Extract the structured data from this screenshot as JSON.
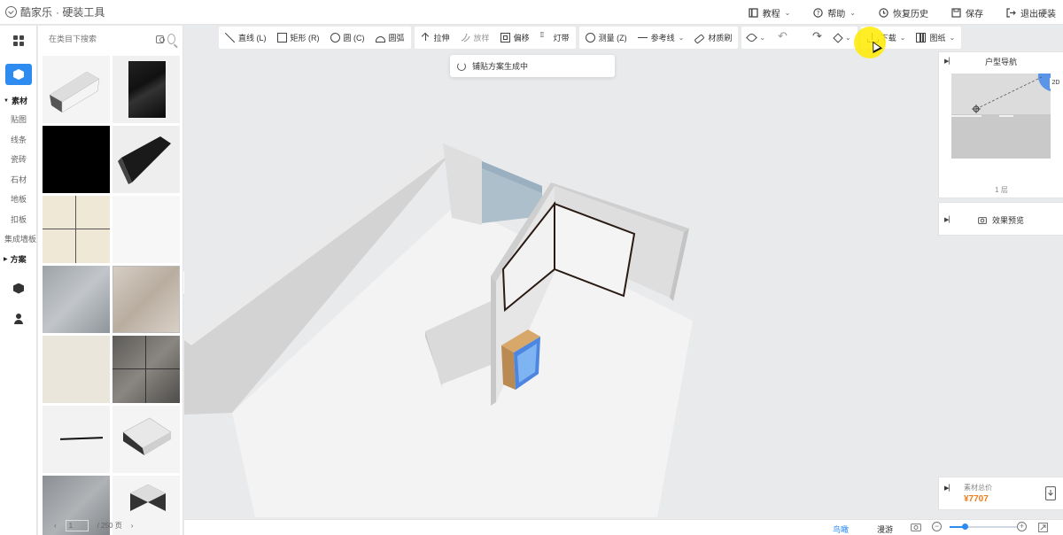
{
  "app": {
    "brand": "酷家乐",
    "module": "· 硬装工具"
  },
  "topbar": {
    "tutorial": "教程",
    "help": "帮助",
    "restore_history": "恢复历史",
    "save": "保存",
    "exit": "退出硬装"
  },
  "sidebar": {
    "group_material": "素材",
    "items": [
      "贴图",
      "线条",
      "瓷砖",
      "石材",
      "地板",
      "扣板",
      "集成墙板"
    ],
    "group_plan": "方案"
  },
  "material_panel": {
    "search_placeholder": "在类目下搜索",
    "pager": {
      "prev": "‹",
      "current": "1",
      "total": "/ 250 页",
      "next": "›"
    }
  },
  "toolbar": {
    "line": "直线 (L)",
    "rect": "矩形 (R)",
    "circle": "圆 (C)",
    "arc": "圆弧",
    "extrude": "拉伸",
    "scale": "放样",
    "offset": "偏移",
    "lightstrip": "灯带",
    "measure": "测量 (Z)",
    "guide": "参考线",
    "material_brush": "材质刷",
    "download": "下载",
    "drawing": "图纸"
  },
  "toast": {
    "message": "铺贴方案生成中"
  },
  "navigator": {
    "title": "户型导航",
    "floor": "1 层",
    "badge": "2D"
  },
  "preview": {
    "title": "效果预览"
  },
  "cost": {
    "label": "素材总价",
    "value": "¥7707"
  },
  "bottombar": {
    "bird_view": "鸟瞰",
    "walk": "漫游"
  },
  "zoom": {
    "level": 0.22
  },
  "colors": {
    "accent": "#2e8bf0",
    "price": "#f07d1a",
    "highlight": "#ffeb00"
  },
  "icons": {
    "camera": "camera-icon",
    "search": "search-icon",
    "undo": "undo-icon",
    "redo": "redo-icon"
  }
}
